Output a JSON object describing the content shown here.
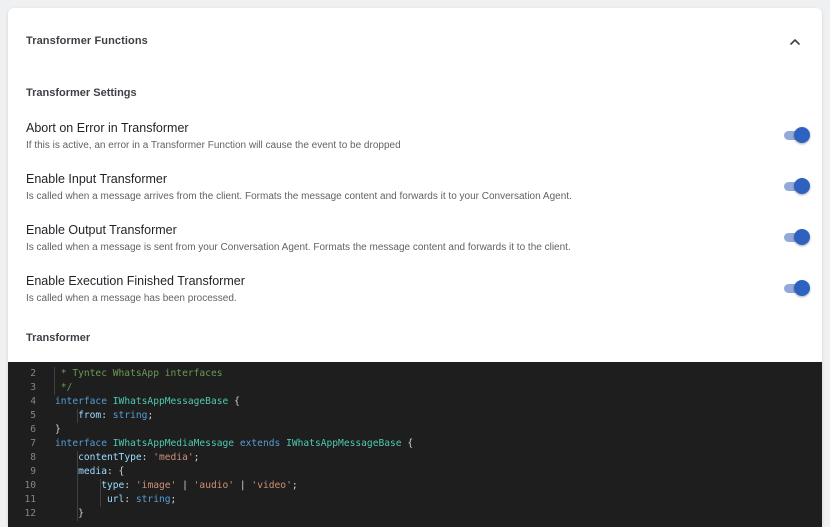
{
  "panel": {
    "title": "Transformer Functions",
    "settings_title": "Transformer Settings",
    "transformer_title": "Transformer"
  },
  "settings": [
    {
      "label": "Abort on Error in Transformer",
      "description": "If this is active, an error in a Transformer Function will cause the event to be dropped",
      "enabled": true
    },
    {
      "label": "Enable Input Transformer",
      "description": "Is called when a message arrives from the client. Formats the message content and forwards it to your Conversation Agent.",
      "enabled": true
    },
    {
      "label": "Enable Output Transformer",
      "description": "Is called when a message is sent from your Conversation Agent. Formats the message content and forwards it to the client.",
      "enabled": true
    },
    {
      "label": "Enable Execution Finished Transformer",
      "description": "Is called when a message has been processed.",
      "enabled": true
    }
  ],
  "colors": {
    "toggle_thumb": "#2f62c0",
    "toggle_track": "#93a9d9",
    "editor_bg": "#1e1e1e"
  },
  "icons": {
    "collapse": "chevron-up-icon"
  },
  "code": {
    "line_numbers": [
      "2",
      "3",
      "4",
      "5",
      "6",
      "7",
      "8",
      "9",
      "10",
      "11",
      "12"
    ],
    "lines": [
      [
        {
          "t": " * Tyntec WhatsApp interfaces",
          "c": "cm"
        }
      ],
      [
        {
          "t": " */",
          "c": "cm"
        }
      ],
      [
        {
          "t": "interface",
          "c": "kw"
        },
        {
          "t": " ",
          "c": "pu"
        },
        {
          "t": "IWhatsAppMessageBase",
          "c": "ty"
        },
        {
          "t": " {",
          "c": "pu"
        }
      ],
      [
        {
          "t": "    ",
          "c": "pu"
        },
        {
          "t": "from",
          "c": "pr"
        },
        {
          "t": ": ",
          "c": "pu"
        },
        {
          "t": "string",
          "c": "kw"
        },
        {
          "t": ";",
          "c": "pu"
        }
      ],
      [
        {
          "t": "}",
          "c": "pu"
        }
      ],
      [
        {
          "t": "interface",
          "c": "kw"
        },
        {
          "t": " ",
          "c": "pu"
        },
        {
          "t": "IWhatsAppMediaMessage",
          "c": "ty"
        },
        {
          "t": " ",
          "c": "pu"
        },
        {
          "t": "extends",
          "c": "kw"
        },
        {
          "t": " ",
          "c": "pu"
        },
        {
          "t": "IWhatsAppMessageBase",
          "c": "ty"
        },
        {
          "t": " {",
          "c": "pu"
        }
      ],
      [
        {
          "t": "    ",
          "c": "pu"
        },
        {
          "t": "contentType",
          "c": "pr"
        },
        {
          "t": ": ",
          "c": "pu"
        },
        {
          "t": "'media'",
          "c": "st"
        },
        {
          "t": ";",
          "c": "pu"
        }
      ],
      [
        {
          "t": "    ",
          "c": "pu"
        },
        {
          "t": "media",
          "c": "pr"
        },
        {
          "t": ": {",
          "c": "pu"
        }
      ],
      [
        {
          "t": "        ",
          "c": "pu"
        },
        {
          "t": "type",
          "c": "pr"
        },
        {
          "t": ": ",
          "c": "pu"
        },
        {
          "t": "'image'",
          "c": "st"
        },
        {
          "t": " | ",
          "c": "pu"
        },
        {
          "t": "'audio'",
          "c": "st"
        },
        {
          "t": " | ",
          "c": "pu"
        },
        {
          "t": "'video'",
          "c": "st"
        },
        {
          "t": ";",
          "c": "pu"
        }
      ],
      [
        {
          "t": "         ",
          "c": "pu"
        },
        {
          "t": "url",
          "c": "pr"
        },
        {
          "t": ": ",
          "c": "pu"
        },
        {
          "t": "string",
          "c": "kw"
        },
        {
          "t": ";",
          "c": "pu"
        }
      ],
      [
        {
          "t": "    }",
          "c": "pu"
        }
      ]
    ]
  }
}
